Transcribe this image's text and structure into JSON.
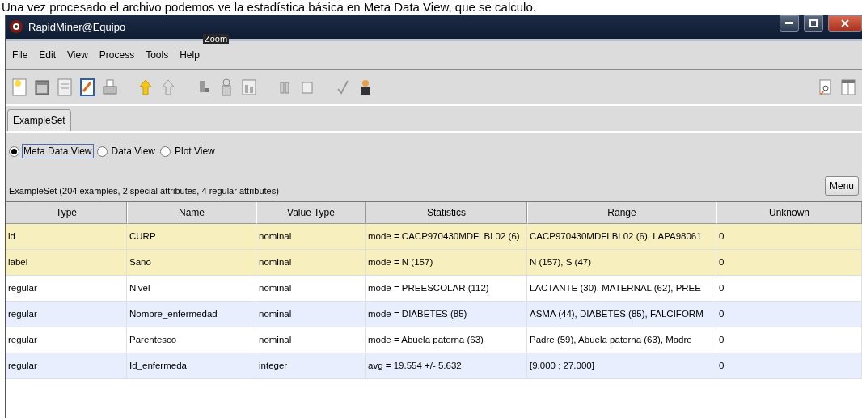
{
  "caption": "Una vez procesado el archivo podemos ve la estadística básica en Meta Data View, que se calculo.",
  "window": {
    "title": "RapidMiner@Equipo",
    "tooltip": "Zoom"
  },
  "menu": [
    "File",
    "Edit",
    "View",
    "Process",
    "Tools",
    "Help"
  ],
  "tabs": [
    {
      "label": "ExampleSet",
      "selected": true
    }
  ],
  "views": [
    {
      "label": "Meta Data View",
      "selected": true
    },
    {
      "label": "Data View",
      "selected": false
    },
    {
      "label": "Plot View",
      "selected": false
    }
  ],
  "summary": "ExampleSet (204 examples, 2 special attributes, 4 regular attributes)",
  "menu_button": "Menu",
  "table": {
    "columns": [
      "Type",
      "Name",
      "Value Type",
      "Statistics",
      "Range",
      "Unknown"
    ],
    "rows": [
      {
        "kind": "special",
        "cells": [
          "id",
          "CURP",
          "nominal",
          "mode = CACP970430MDFLBL02 (6)",
          "CACP970430MDFLBL02 (6), LAPA98061",
          "0"
        ]
      },
      {
        "kind": "special",
        "cells": [
          "label",
          "Sano",
          "nominal",
          "mode = N (157)",
          "N (157), S (47)",
          "0"
        ]
      },
      {
        "kind": "regular",
        "cells": [
          "regular",
          "Nivel",
          "nominal",
          "mode = PREESCOLAR (112)",
          "LACTANTE (30), MATERNAL (62), PREE",
          "0"
        ]
      },
      {
        "kind": "regular",
        "cells": [
          "regular",
          "Nombre_enfermedad",
          "nominal",
          "mode = DIABETES (85)",
          "ASMA (44), DIABETES (85), FALCIFORM",
          "0"
        ]
      },
      {
        "kind": "regular",
        "cells": [
          "regular",
          "Parentesco",
          "nominal",
          "mode = Abuela paterna (63)",
          "Padre (59), Abuela paterna (63), Madre",
          "0"
        ]
      },
      {
        "kind": "regular",
        "cells": [
          "regular",
          "Id_enfermeda",
          "integer",
          "avg = 19.554 +/- 5.632",
          "[9.000 ; 27.000]",
          "0"
        ]
      }
    ]
  }
}
